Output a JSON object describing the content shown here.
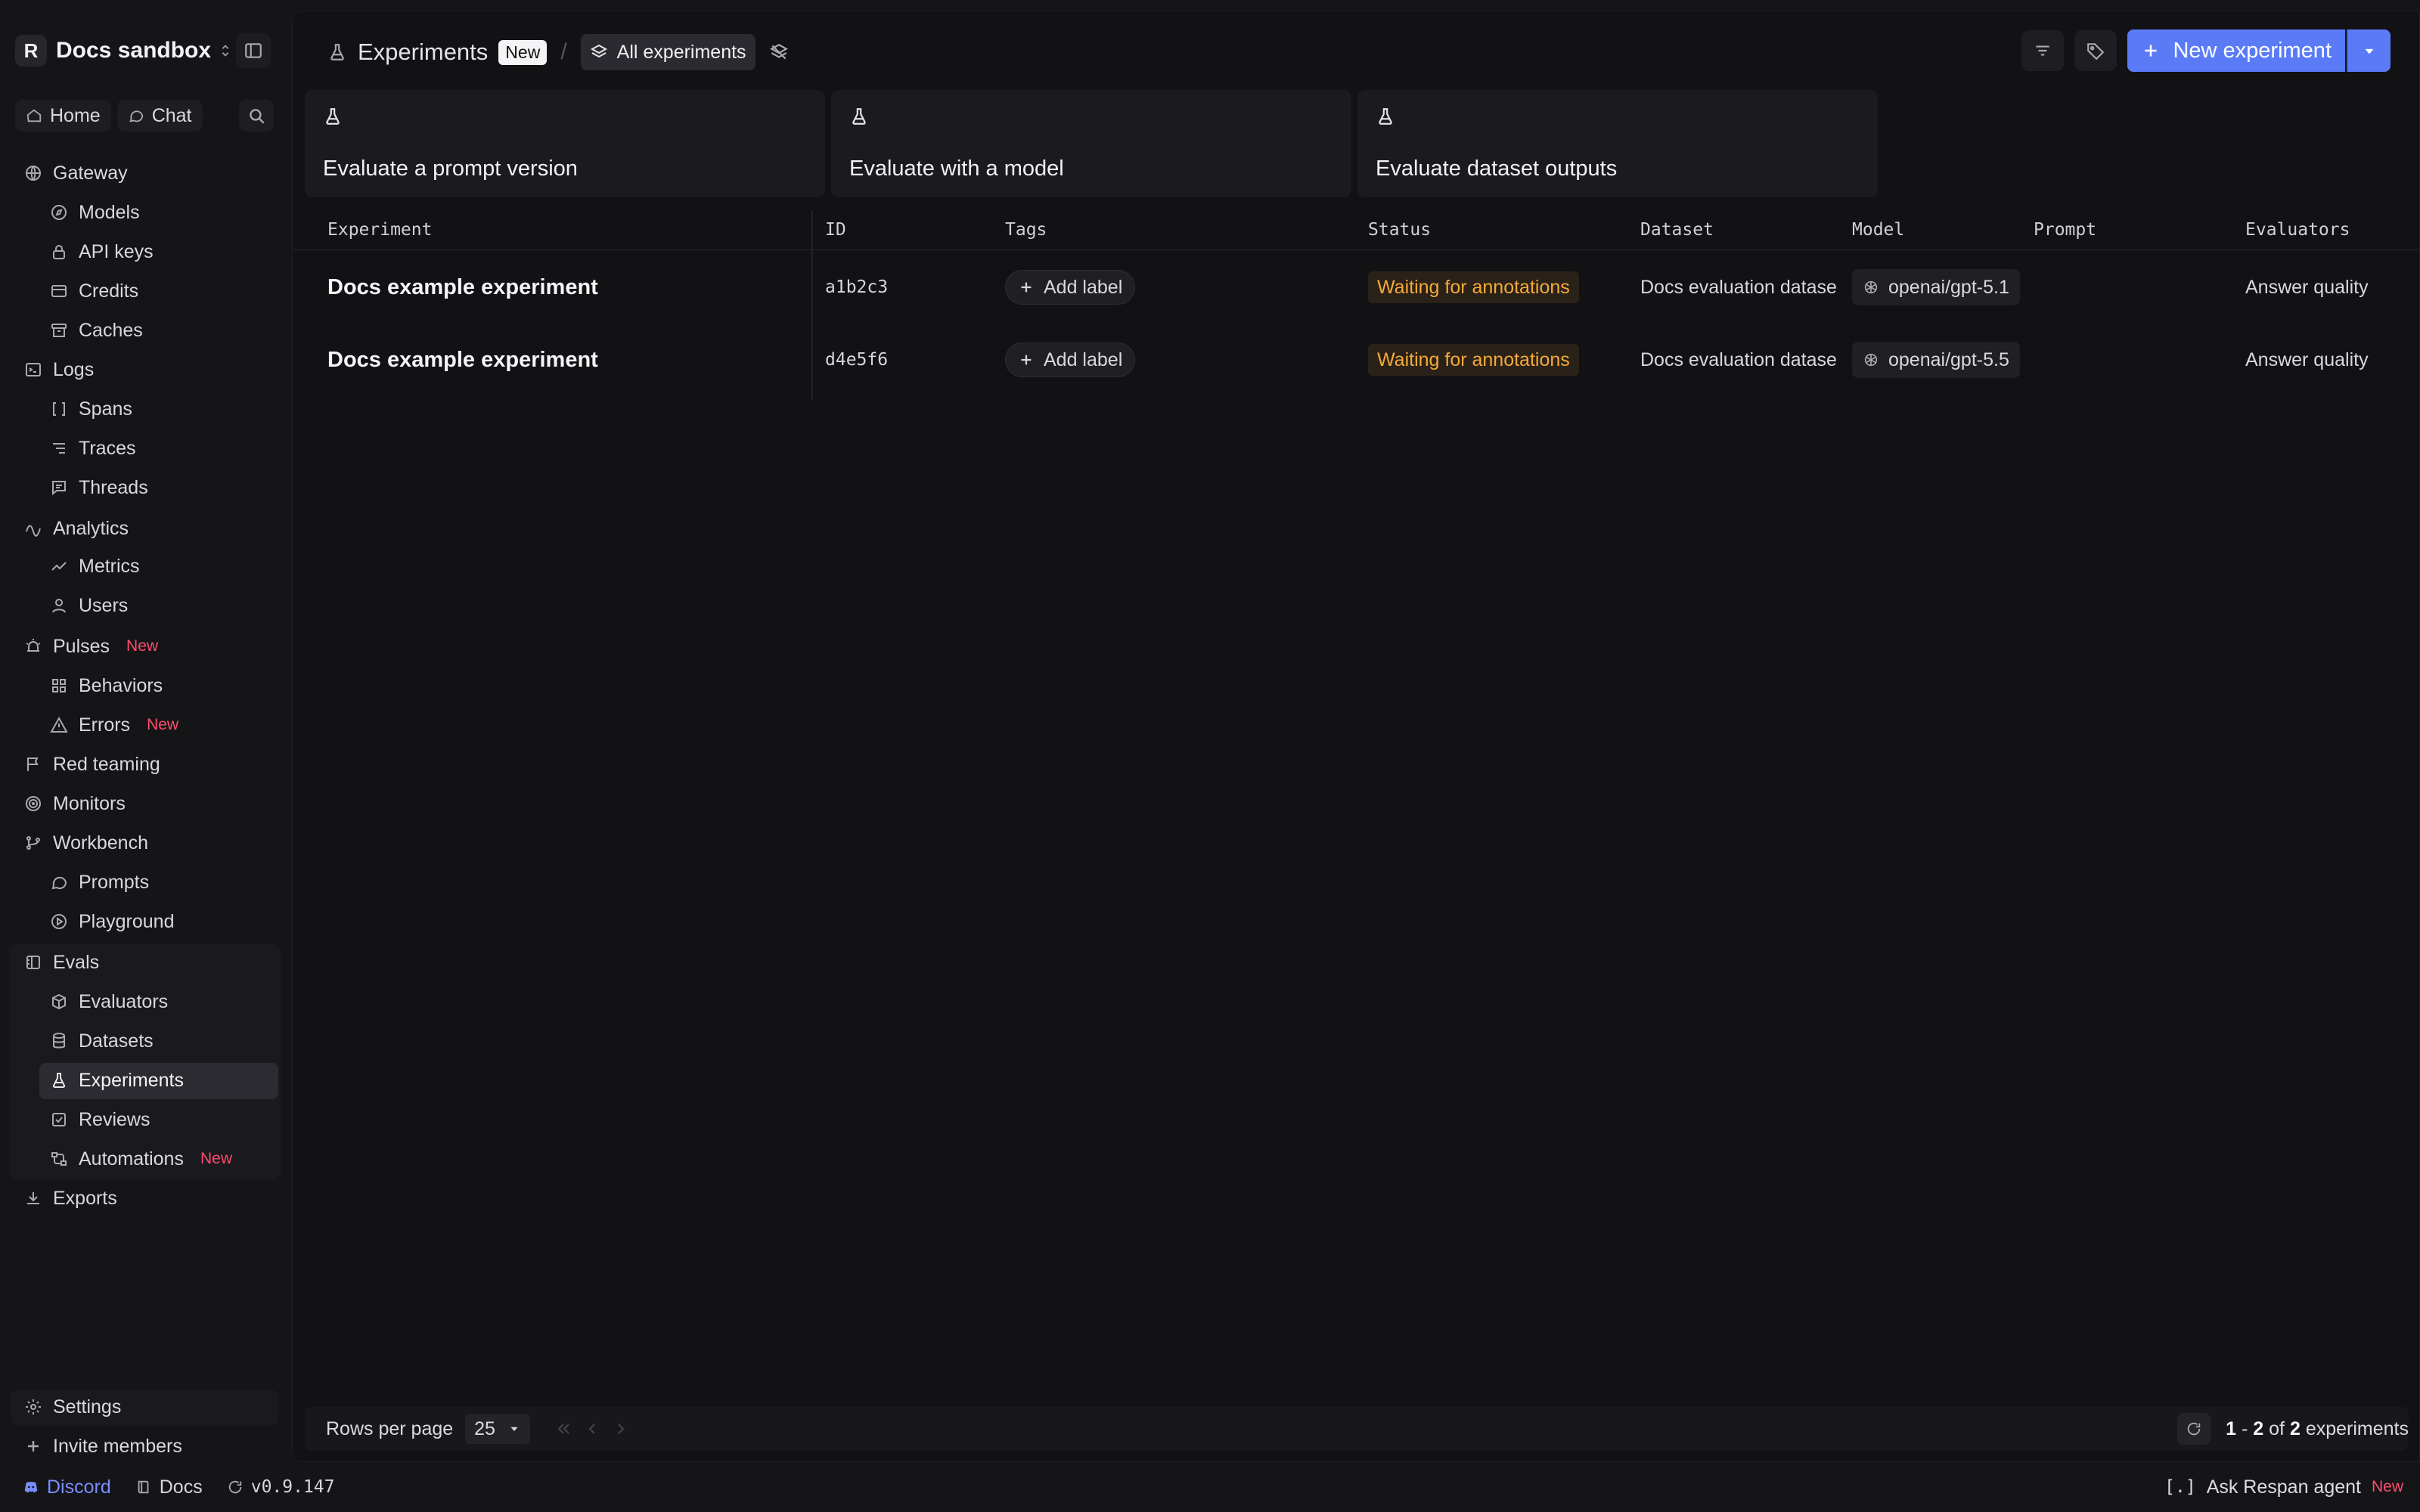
{
  "workspace": {
    "avatar": "R",
    "name": "Docs sandbox"
  },
  "quick": {
    "home": "Home",
    "chat": "Chat"
  },
  "nav": {
    "gateway": "Gateway",
    "models": "Models",
    "api_keys": "API keys",
    "credits": "Credits",
    "caches": "Caches",
    "logs": "Logs",
    "spans": "Spans",
    "traces": "Traces",
    "threads": "Threads",
    "analytics": "Analytics",
    "metrics": "Metrics",
    "users": "Users",
    "pulses": "Pulses",
    "behaviors": "Behaviors",
    "errors": "Errors",
    "red_teaming": "Red teaming",
    "monitors": "Monitors",
    "workbench": "Workbench",
    "prompts": "Prompts",
    "playground": "Playground",
    "evals": "Evals",
    "evaluators": "Evaluators",
    "datasets": "Datasets",
    "experiments": "Experiments",
    "reviews": "Reviews",
    "automations": "Automations",
    "exports": "Exports",
    "settings": "Settings",
    "invite": "Invite members",
    "new_badge": "New"
  },
  "footer": {
    "discord": "Discord",
    "docs": "Docs",
    "version": "v0.9.147",
    "ask_agent": "Ask Respan agent",
    "ask_agent_badge": "New",
    "ask_agent_glyph": "[.]"
  },
  "header": {
    "title": "Experiments",
    "title_badge": "New",
    "separator": "/",
    "view": "All experiments",
    "new_experiment": "New experiment"
  },
  "cards": [
    "Evaluate a prompt version",
    "Evaluate with a model",
    "Evaluate dataset outputs"
  ],
  "table": {
    "columns": [
      "Experiment",
      "ID",
      "Tags",
      "Status",
      "Dataset",
      "Model",
      "Prompt",
      "Evaluators"
    ],
    "add_label": "Add label",
    "rows": [
      {
        "experiment": "Docs example experiment",
        "id": "a1b2c3",
        "status": "Waiting for annotations",
        "dataset": "Docs evaluation datase",
        "model": "openai/gpt-5.1",
        "prompt": "",
        "evaluators": "Answer quality"
      },
      {
        "experiment": "Docs example experiment",
        "id": "d4e5f6",
        "status": "Waiting for annotations",
        "dataset": "Docs evaluation datase",
        "model": "openai/gpt-5.5",
        "prompt": "",
        "evaluators": "Answer quality"
      }
    ]
  },
  "pagination": {
    "rows_per_page_label": "Rows per page",
    "rows_per_page": "25",
    "range_start": "1",
    "dash": "-",
    "range_end": "2",
    "of": "of",
    "total": "2",
    "unit": "experiments"
  },
  "colors": {
    "accent": "#5b7bf6",
    "status_warning": "#f5a93a",
    "new_badge": "#ff4d6d",
    "discord": "#7b8cff"
  }
}
